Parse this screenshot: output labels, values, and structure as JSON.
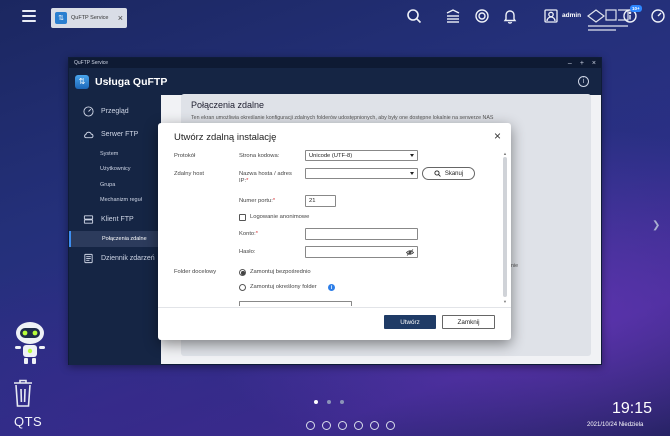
{
  "taskbar": {
    "app_tab_label": "QuFTP Service",
    "user": "admin",
    "notification_badge": "10+"
  },
  "window": {
    "titlebar": "QuFTP Service",
    "app_title": "Usługa QuFTP"
  },
  "sidebar": {
    "items": [
      {
        "label": "Przegląd",
        "icon": "speedometer-icon"
      },
      {
        "label": "Serwer FTP",
        "icon": "cloud-icon"
      },
      {
        "label": "System"
      },
      {
        "label": "Użytkownicy"
      },
      {
        "label": "Grupa"
      },
      {
        "label": "Mechanizm reguł"
      },
      {
        "label": "Klient FTP",
        "icon": "server-icon"
      },
      {
        "label": "Połączenia zdalne",
        "active": true
      },
      {
        "label": "Dziennik zdarzeń",
        "icon": "log-icon"
      }
    ]
  },
  "content": {
    "title": "Połączenia zdalne",
    "description": "Ten ekran umożliwia określanie konfiguracji zdalnych folderów udostępnionych, aby były one dostępne lokalnie na serwerze NAS",
    "fragment": "nie"
  },
  "modal": {
    "title": "Utwórz zdalną instalację",
    "protocol_label": "Protokół",
    "encoding_label": "Strona kodowa:",
    "encoding_value": "Unicode (UTF-8)",
    "remote_host_label": "Zdalny host",
    "host_name_label": "Nazwa hosta / adres",
    "host_name_label_2": "IP:",
    "host_value": "",
    "scan_button": "Skanuj",
    "port_label": "Numer portu:",
    "port_value": "21",
    "anonymous_label": "Logowanie anonimowe",
    "account_label": "Konto:",
    "account_value": "",
    "password_label": "Hasło:",
    "password_value": "",
    "target_folder_label": "Folder docelowy",
    "mount_direct_label": "Zamontuj bezpośrednio",
    "mount_folder_label": "Zamontuj określony folder",
    "primary_button": "Utwórz",
    "cancel_button": "Zamknij"
  },
  "desktop": {
    "os_label": "QTS",
    "time": "19:15",
    "date": "2021/10/24 Niedziela"
  },
  "colors": {
    "window_dark": "#152544",
    "primary_button": "#1f3b66",
    "accent_blue": "#2d7ee8",
    "required": "#d9343a"
  }
}
